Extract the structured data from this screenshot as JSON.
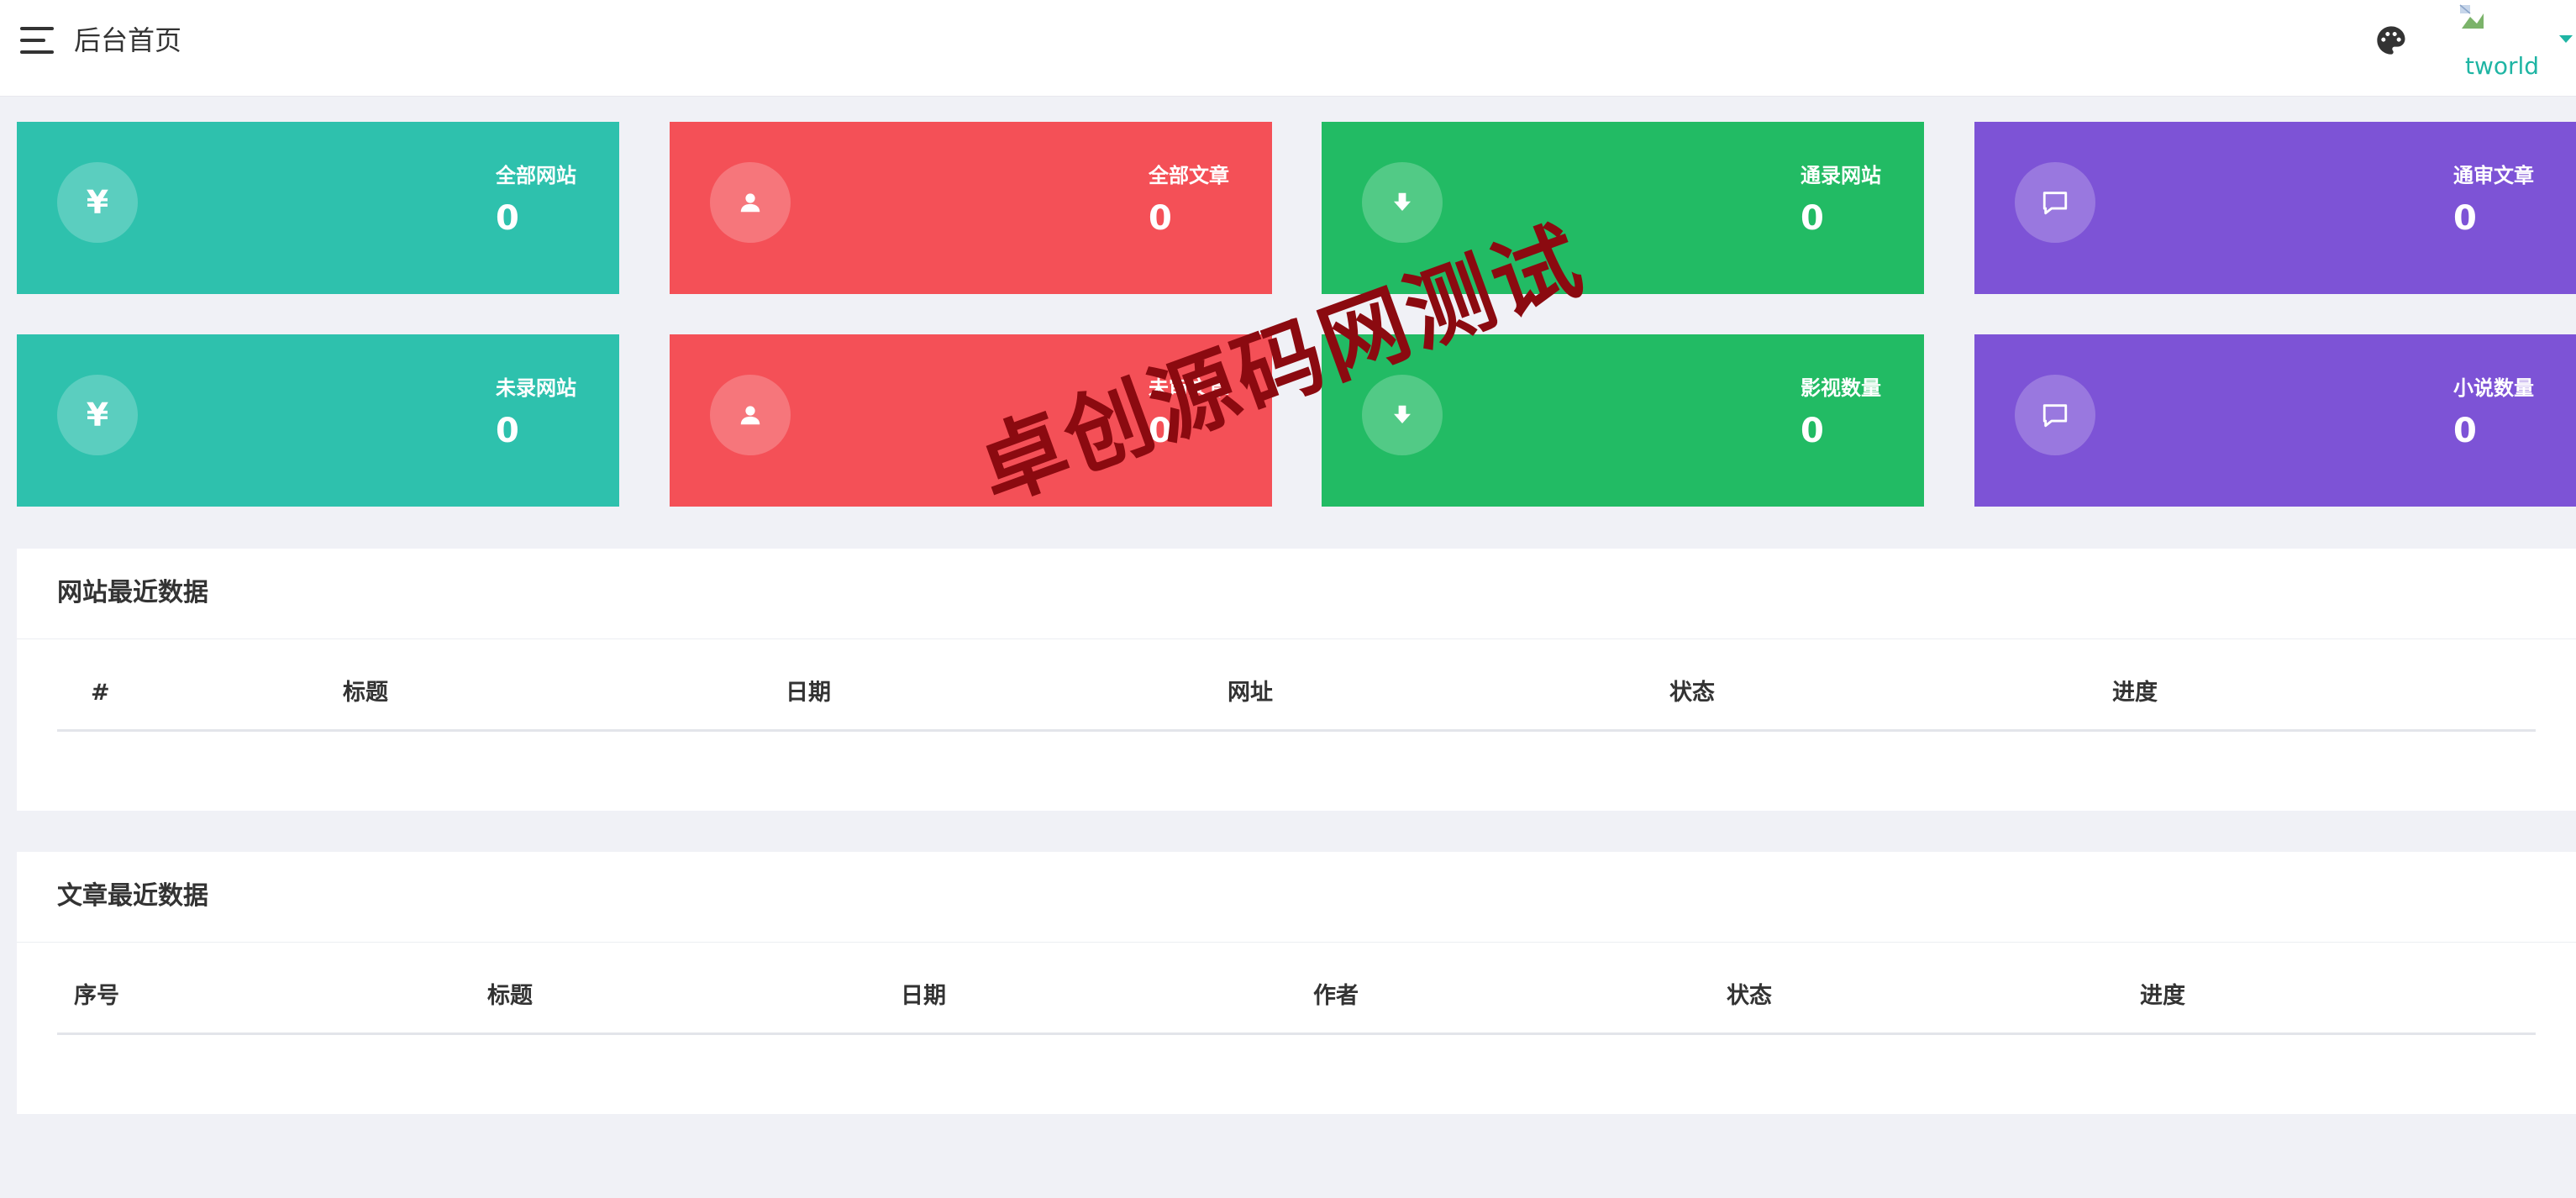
{
  "header": {
    "title": "后台首页",
    "user_name": "tworld",
    "theme_icon": "palette-icon",
    "menu_icon": "hamburger-menu-icon"
  },
  "cards": [
    {
      "label": "全部网站",
      "value": "0",
      "icon": "yen-icon",
      "color": "#2ec1ad"
    },
    {
      "label": "全部文章",
      "value": "0",
      "icon": "user-icon",
      "color": "#f45057"
    },
    {
      "label": "通录网站",
      "value": "0",
      "icon": "download-arrow-icon",
      "color": "#22bb64"
    },
    {
      "label": "通审文章",
      "value": "0",
      "icon": "comment-icon",
      "color": "#7d53d6"
    },
    {
      "label": "未录网站",
      "value": "0",
      "icon": "yen-icon",
      "color": "#2ec1ad"
    },
    {
      "label": "未审文章",
      "value": "0",
      "icon": "user-icon",
      "color": "#f45057"
    },
    {
      "label": "影视数量",
      "value": "0",
      "icon": "download-arrow-icon",
      "color": "#22bb64"
    },
    {
      "label": "小说数量",
      "value": "0",
      "icon": "comment-icon",
      "color": "#7d53d6"
    }
  ],
  "site_panel": {
    "title": "网站最近数据",
    "columns": [
      "#",
      "标题",
      "日期",
      "网址",
      "状态",
      "进度"
    ]
  },
  "article_panel": {
    "title": "文章最近数据",
    "columns": [
      "序号",
      "标题",
      "日期",
      "作者",
      "状态",
      "进度"
    ]
  },
  "watermark": "卓创源码网测试"
}
